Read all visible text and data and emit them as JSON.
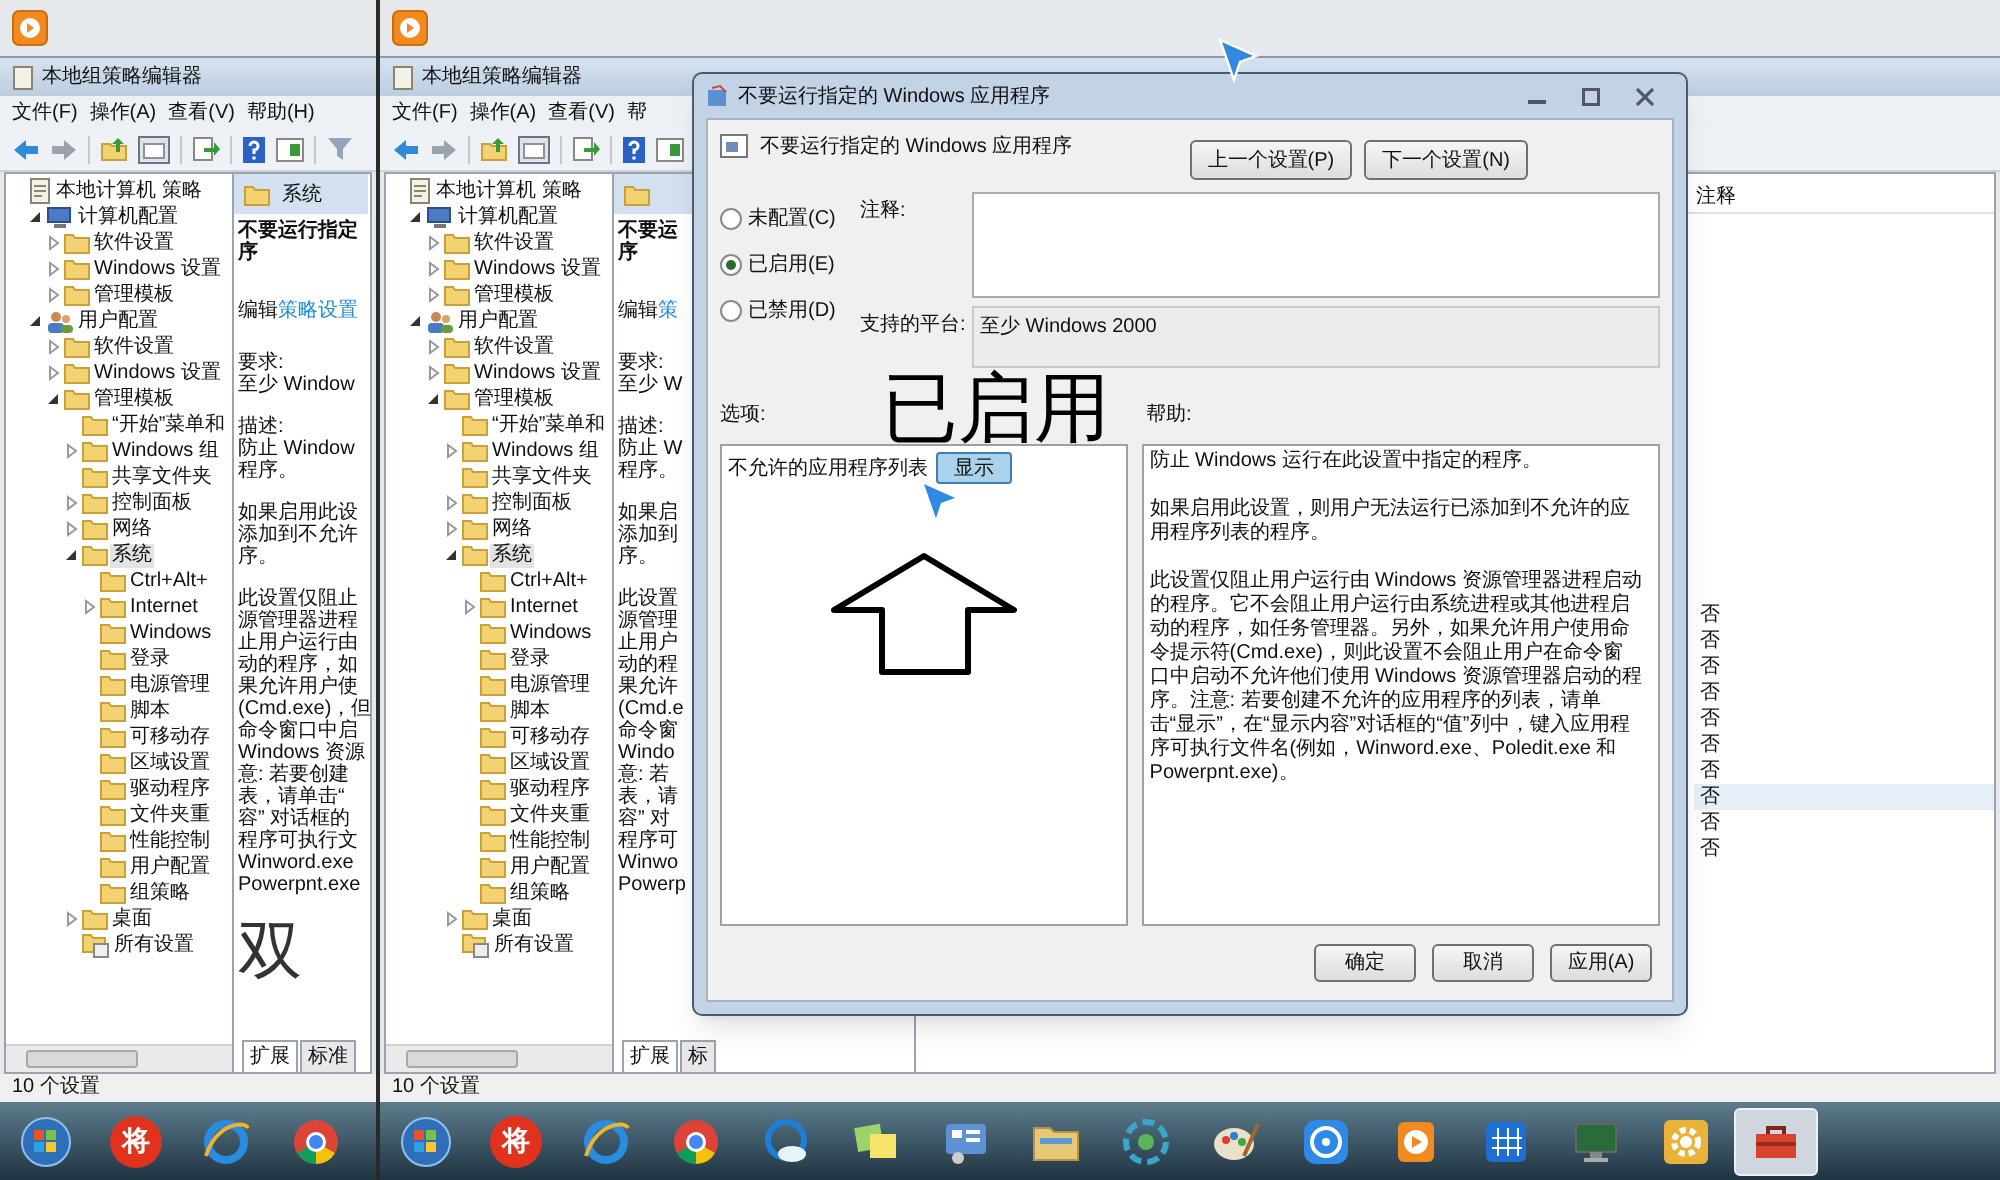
{
  "panels": [
    {
      "app_window": {
        "title": "本地组策略编辑器",
        "menu": [
          "文件(F)",
          "操作(A)",
          "查看(V)",
          "帮助(H)"
        ],
        "tree": [
          {
            "label": "本地计算机 策略",
            "kind": "policy",
            "selected": false,
            "children": [
              {
                "label": "计算机配置",
                "kind": "computer",
                "expanded": true,
                "selected": false,
                "children": [
                  {
                    "label": "软件设置",
                    "kind": "folder",
                    "expanded": false,
                    "selected": false
                  },
                  {
                    "label": "Windows 设置",
                    "kind": "folder",
                    "expanded": false,
                    "selected": false
                  },
                  {
                    "label": "管理模板",
                    "kind": "folder",
                    "expanded": false,
                    "selected": false
                  }
                ]
              },
              {
                "label": "用户配置",
                "kind": "user",
                "expanded": true,
                "selected": false,
                "children": [
                  {
                    "label": "软件设置",
                    "kind": "folder",
                    "expanded": false,
                    "selected": false
                  },
                  {
                    "label": "Windows 设置",
                    "kind": "folder",
                    "expanded": false,
                    "selected": false
                  },
                  {
                    "label": "管理模板",
                    "kind": "folder",
                    "expanded": true,
                    "selected": false,
                    "children": [
                      {
                        "label": "“开始”菜单和",
                        "kind": "folder",
                        "selected": false
                      },
                      {
                        "label": "Windows 组",
                        "kind": "folder",
                        "expanded": false,
                        "selected": false
                      },
                      {
                        "label": "共享文件夹",
                        "kind": "folder",
                        "selected": false
                      },
                      {
                        "label": "控制面板",
                        "kind": "folder",
                        "expanded": false,
                        "selected": false
                      },
                      {
                        "label": "网络",
                        "kind": "folder",
                        "expanded": false,
                        "selected": false
                      },
                      {
                        "label": "系统",
                        "kind": "folder",
                        "expanded": true,
                        "selected": true,
                        "children": [
                          {
                            "label": "Ctrl+Alt+",
                            "kind": "folder",
                            "selected": false
                          },
                          {
                            "label": "Internet",
                            "kind": "folder",
                            "expanded": false,
                            "selected": false
                          },
                          {
                            "label": "Windows",
                            "kind": "folder",
                            "selected": false
                          },
                          {
                            "label": "登录",
                            "kind": "folder",
                            "selected": false
                          },
                          {
                            "label": "电源管理",
                            "kind": "folder",
                            "selected": false
                          },
                          {
                            "label": "脚本",
                            "kind": "folder",
                            "selected": false
                          },
                          {
                            "label": "可移动存",
                            "kind": "folder",
                            "selected": false
                          },
                          {
                            "label": "区域设置",
                            "kind": "folder",
                            "selected": false
                          },
                          {
                            "label": "驱动程序",
                            "kind": "folder",
                            "selected": false
                          },
                          {
                            "label": "文件夹重",
                            "kind": "folder",
                            "selected": false
                          },
                          {
                            "label": "性能控制",
                            "kind": "folder",
                            "selected": false
                          },
                          {
                            "label": "用户配置",
                            "kind": "folder",
                            "selected": false
                          },
                          {
                            "label": "组策略",
                            "kind": "folder",
                            "selected": false
                          }
                        ]
                      },
                      {
                        "label": "桌面",
                        "kind": "folder",
                        "expanded": false,
                        "selected": false
                      },
                      {
                        "label": "所有设置",
                        "kind": "all_settings",
                        "selected": false
                      }
                    ]
                  }
                ]
              }
            ]
          }
        ],
        "details": {
          "header": "系统",
          "blocks": [
            {
              "kind": "title",
              "lines": [
                "不要运行指定",
                "序"
              ]
            },
            {
              "kind": "edit",
              "text": "编辑",
              "link": "策略设置"
            },
            {
              "kind": "para",
              "lines": [
                "要求:",
                "至少 Window"
              ]
            },
            {
              "kind": "para",
              "lines": [
                "描述:",
                "防止 Window",
                "程序。"
              ]
            },
            {
              "kind": "para",
              "lines": [
                "如果启用此设",
                "添加到不允许",
                "序。"
              ]
            },
            {
              "kind": "para",
              "lines": [
                "此设置仅阻止",
                "源管理器进程",
                "止用户运行由",
                "动的程序，如",
                "果允许用户使",
                "(Cmd.exe)，但",
                "命令窗口中启",
                "Windows 资源",
                "意: 若要创建",
                "表，请单击“",
                "容” 对话框的",
                "程序可执行文",
                "Winword.exe",
                "Powerpnt.exe"
              ]
            }
          ],
          "annotation": "双"
        },
        "tabs": [
          {
            "label": "扩展",
            "selected": true
          },
          {
            "label": "标准",
            "selected": false
          }
        ],
        "status_bar": "10 个设置"
      },
      "taskbar": [
        {
          "kind": "start",
          "active": false
        },
        {
          "kind": "badge",
          "label": "将",
          "active": false
        },
        {
          "kind": "ie",
          "active": false
        },
        {
          "kind": "chrome",
          "active": false
        }
      ]
    },
    {
      "app_window": {
        "title": "本地组策略编辑器",
        "menu": [
          "文件(F)",
          "操作(A)",
          "查看(V)",
          "帮"
        ],
        "tree": [
          {
            "label": "本地计算机 策略",
            "kind": "policy",
            "selected": false,
            "children": [
              {
                "label": "计算机配置",
                "kind": "computer",
                "expanded": true,
                "selected": false,
                "children": [
                  {
                    "label": "软件设置",
                    "kind": "folder",
                    "expanded": false,
                    "selected": false
                  },
                  {
                    "label": "Windows 设置",
                    "kind": "folder",
                    "expanded": false,
                    "selected": false
                  },
                  {
                    "label": "管理模板",
                    "kind": "folder",
                    "expanded": false,
                    "selected": false
                  }
                ]
              },
              {
                "label": "用户配置",
                "kind": "user",
                "expanded": true,
                "selected": false,
                "children": [
                  {
                    "label": "软件设置",
                    "kind": "folder",
                    "expanded": false,
                    "selected": false
                  },
                  {
                    "label": "Windows 设置",
                    "kind": "folder",
                    "expanded": false,
                    "selected": false
                  },
                  {
                    "label": "管理模板",
                    "kind": "folder",
                    "expanded": true,
                    "selected": false,
                    "children": [
                      {
                        "label": "“开始”菜单和",
                        "kind": "folder",
                        "selected": false
                      },
                      {
                        "label": "Windows 组",
                        "kind": "folder",
                        "expanded": false,
                        "selected": false
                      },
                      {
                        "label": "共享文件夹",
                        "kind": "folder",
                        "selected": false
                      },
                      {
                        "label": "控制面板",
                        "kind": "folder",
                        "expanded": false,
                        "selected": false
                      },
                      {
                        "label": "网络",
                        "kind": "folder",
                        "expanded": false,
                        "selected": false
                      },
                      {
                        "label": "系统",
                        "kind": "folder",
                        "expanded": true,
                        "selected": true,
                        "children": [
                          {
                            "label": "Ctrl+Alt+",
                            "kind": "folder",
                            "selected": false
                          },
                          {
                            "label": "Internet",
                            "kind": "folder",
                            "expanded": false,
                            "selected": false
                          },
                          {
                            "label": "Windows",
                            "kind": "folder",
                            "selected": false
                          },
                          {
                            "label": "登录",
                            "kind": "folder",
                            "selected": false
                          },
                          {
                            "label": "电源管理",
                            "kind": "folder",
                            "selected": false
                          },
                          {
                            "label": "脚本",
                            "kind": "folder",
                            "selected": false
                          },
                          {
                            "label": "可移动存",
                            "kind": "folder",
                            "selected": false
                          },
                          {
                            "label": "区域设置",
                            "kind": "folder",
                            "selected": false
                          },
                          {
                            "label": "驱动程序",
                            "kind": "folder",
                            "selected": false
                          },
                          {
                            "label": "文件夹重",
                            "kind": "folder",
                            "selected": false
                          },
                          {
                            "label": "性能控制",
                            "kind": "folder",
                            "selected": false
                          },
                          {
                            "label": "用户配置",
                            "kind": "folder",
                            "selected": false
                          },
                          {
                            "label": "组策略",
                            "kind": "folder",
                            "selected": false
                          }
                        ]
                      },
                      {
                        "label": "桌面",
                        "kind": "folder",
                        "expanded": false,
                        "selected": false
                      },
                      {
                        "label": "所有设置",
                        "kind": "all_settings",
                        "selected": false
                      }
                    ]
                  }
                ]
              }
            ]
          }
        ],
        "details": {
          "blocks": [
            {
              "kind": "title",
              "lines": [
                "不要运",
                "序"
              ]
            },
            {
              "kind": "edit",
              "text": "编辑",
              "link": "策"
            },
            {
              "kind": "para",
              "lines": [
                "要求:",
                "至少 W"
              ]
            },
            {
              "kind": "para",
              "lines": [
                "描述:",
                "防止 W",
                "程序。"
              ]
            },
            {
              "kind": "para",
              "lines": [
                "如果启",
                "添加到",
                "序。"
              ]
            },
            {
              "kind": "para",
              "lines": [
                "此设置",
                "源管理",
                "止用户",
                "动的程",
                "果允许",
                "(Cmd.e",
                "命令窗",
                "Windo",
                "意: 若",
                "表，请",
                "容” 对",
                "程序可",
                "Winwo",
                "Powerp"
              ]
            }
          ]
        },
        "tabs": [
          {
            "label": "扩展",
            "selected": true
          },
          {
            "label": "标",
            "selected": false
          }
        ],
        "list": {
          "column_2": "注释",
          "rows": [
            {
              "column_2": "否",
              "selected": false
            },
            {
              "column_2": "否",
              "selected": false
            },
            {
              "column_2": "否",
              "selected": false
            },
            {
              "column_2": "否",
              "selected": false
            },
            {
              "column_2": "否",
              "selected": false
            },
            {
              "column_2": "否",
              "selected": false
            },
            {
              "column_2": "否",
              "selected": false
            },
            {
              "column_2": "否",
              "selected": true
            },
            {
              "column_2": "否",
              "selected": false
            },
            {
              "column_2": "否",
              "selected": false
            }
          ]
        },
        "status_bar": "10 个设置"
      },
      "dialog": {
        "title": "不要运行指定的 Windows 应用程序",
        "heading": "不要运行指定的 Windows 应用程序",
        "nav_buttons": [
          "上一个设置(P)",
          "下一个设置(N)"
        ],
        "states": [
          {
            "label": "未配置(C)",
            "selected": false
          },
          {
            "label": "已启用(E)",
            "selected": true
          },
          {
            "label": "已禁用(D)",
            "selected": false
          }
        ],
        "comment_label": "注释:",
        "platform_label": "支持的平台:",
        "platform": "至少 Windows 2000",
        "options_label": "选项:",
        "help_label": "帮助:",
        "options": [
          {
            "label": "不允许的应用程序列表",
            "button": "显示"
          }
        ],
        "help": [
          "防止 Windows 运行在此设置中指定的程序。",
          "如果启用此设置，则用户无法运行已添加到不允许的应用程序列表的程序。",
          "此设置仅阻止用户运行由 Windows 资源管理器进程启动的程序。它不会阻止用户运行由系统进程或其他进程启动的程序，如任务管理器。另外，如果允许用户使用命令提示符(Cmd.exe)，则此设置不会阻止用户在命令窗口中启动不允许他们使用 Windows 资源管理器启动的程序。注意: 若要创建不允许的应用程序的列表，请单击“显示”，在“显示内容”对话框的“值”列中，键入应用程序可执行文件名(例如，Winword.exe、Poledit.exe 和 Powerpnt.exe)。"
        ],
        "buttons": [
          "确定",
          "取消",
          "应用(A)"
        ],
        "annotation": "已启用"
      },
      "taskbar": [
        {
          "kind": "start",
          "active": false
        },
        {
          "kind": "badge",
          "label": "将",
          "active": false
        },
        {
          "kind": "ie",
          "active": false
        },
        {
          "kind": "chrome",
          "active": false
        },
        {
          "kind": "cloud",
          "active": false
        },
        {
          "kind": "notes",
          "active": false
        },
        {
          "kind": "control_panel",
          "active": false
        },
        {
          "kind": "explorer",
          "active": false
        },
        {
          "kind": "pinwheel",
          "active": false
        },
        {
          "kind": "paint",
          "active": false
        },
        {
          "kind": "media",
          "active": false
        },
        {
          "kind": "player",
          "active": false
        },
        {
          "kind": "grid",
          "active": false
        },
        {
          "kind": "monitor",
          "active": false
        },
        {
          "kind": "gear",
          "active": false
        },
        {
          "kind": "toolbox",
          "active": true
        }
      ]
    }
  ]
}
